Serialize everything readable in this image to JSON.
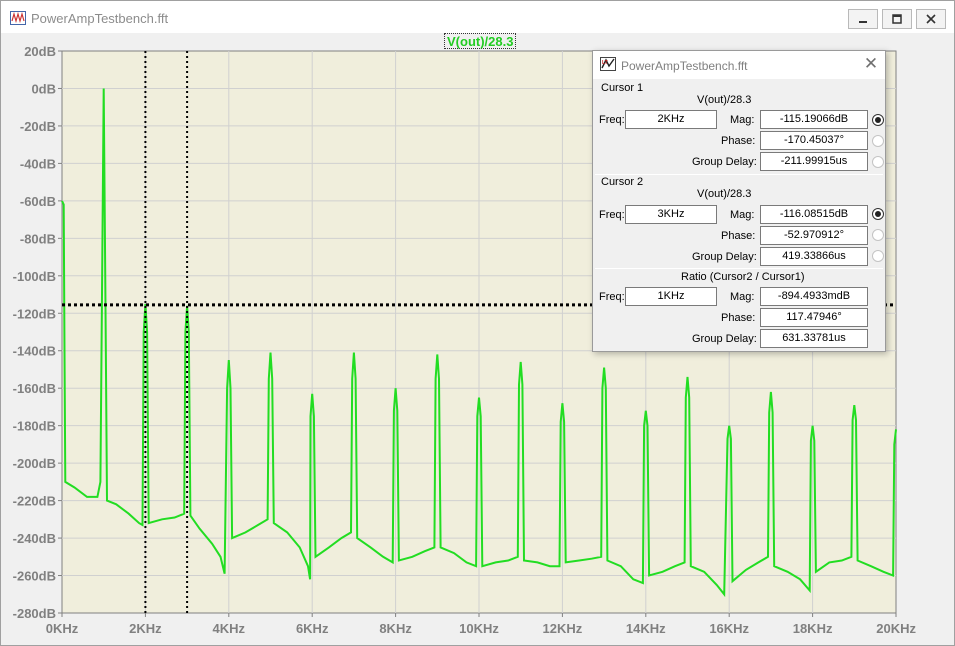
{
  "window": {
    "title": "PowerAmpTestbench.fft",
    "icon": "waveform-app-icon",
    "buttons": [
      "minimize-icon",
      "maximize-icon",
      "close-icon"
    ]
  },
  "trace_label": "V(out)/28.3",
  "colors": {
    "trace": "#22dd22",
    "plot_background": "#f0eedc",
    "grid": "#d0d0d0",
    "tick_label": "#808080",
    "cursor": "#000000"
  },
  "chart_data": {
    "type": "line",
    "title": "",
    "xlabel": "",
    "ylabel": "",
    "xlim": [
      0,
      20000
    ],
    "ylim": [
      -280,
      20
    ],
    "x_unit": "Hz",
    "y_unit": "dB",
    "x_ticks": [
      "0KHz",
      "2KHz",
      "4KHz",
      "6KHz",
      "8KHz",
      "10KHz",
      "12KHz",
      "14KHz",
      "16KHz",
      "18KHz",
      "20KHz"
    ],
    "y_ticks": [
      "20dB",
      "0dB",
      "-20dB",
      "-40dB",
      "-60dB",
      "-80dB",
      "-100dB",
      "-120dB",
      "-140dB",
      "-160dB",
      "-180dB",
      "-200dB",
      "-220dB",
      "-240dB",
      "-260dB",
      "-280dB"
    ],
    "grid": true,
    "series": [
      {
        "name": "V(out)/28.3",
        "points": [
          [
            0,
            -60
          ],
          [
            40,
            -62
          ],
          [
            60,
            -140
          ],
          [
            80,
            -210
          ],
          [
            300,
            -213
          ],
          [
            600,
            -218
          ],
          [
            850,
            -218
          ],
          [
            920,
            -210
          ],
          [
            960,
            -110
          ],
          [
            1000,
            0
          ],
          [
            1040,
            -110
          ],
          [
            1080,
            -220
          ],
          [
            1300,
            -222
          ],
          [
            1600,
            -227
          ],
          [
            1850,
            -232
          ],
          [
            1930,
            -233
          ],
          [
            1960,
            -130
          ],
          [
            2000,
            -115
          ],
          [
            2040,
            -130
          ],
          [
            2080,
            -232
          ],
          [
            2400,
            -230
          ],
          [
            2700,
            -229
          ],
          [
            2930,
            -227
          ],
          [
            2960,
            -130
          ],
          [
            3000,
            -116
          ],
          [
            3040,
            -130
          ],
          [
            3080,
            -228
          ],
          [
            3300,
            -235
          ],
          [
            3600,
            -243
          ],
          [
            3800,
            -250
          ],
          [
            3900,
            -259
          ],
          [
            3960,
            -160
          ],
          [
            4000,
            -145
          ],
          [
            4040,
            -160
          ],
          [
            4080,
            -240
          ],
          [
            4400,
            -237
          ],
          [
            4700,
            -233
          ],
          [
            4930,
            -230
          ],
          [
            4960,
            -155
          ],
          [
            5000,
            -141
          ],
          [
            5040,
            -155
          ],
          [
            5080,
            -232
          ],
          [
            5400,
            -237
          ],
          [
            5700,
            -245
          ],
          [
            5900,
            -255
          ],
          [
            5950,
            -262
          ],
          [
            5960,
            -175
          ],
          [
            6000,
            -163
          ],
          [
            6040,
            -175
          ],
          [
            6080,
            -250
          ],
          [
            6400,
            -245
          ],
          [
            6700,
            -240
          ],
          [
            6930,
            -237
          ],
          [
            6960,
            -155
          ],
          [
            7000,
            -141
          ],
          [
            7040,
            -155
          ],
          [
            7080,
            -240
          ],
          [
            7400,
            -245
          ],
          [
            7700,
            -250
          ],
          [
            7930,
            -253
          ],
          [
            7960,
            -172
          ],
          [
            8000,
            -160
          ],
          [
            8040,
            -172
          ],
          [
            8080,
            -252
          ],
          [
            8400,
            -250
          ],
          [
            8700,
            -247
          ],
          [
            8930,
            -245
          ],
          [
            8960,
            -155
          ],
          [
            9000,
            -142
          ],
          [
            9040,
            -155
          ],
          [
            9080,
            -245
          ],
          [
            9400,
            -248
          ],
          [
            9700,
            -253
          ],
          [
            9930,
            -255
          ],
          [
            9960,
            -175
          ],
          [
            10000,
            -165
          ],
          [
            10040,
            -175
          ],
          [
            10080,
            -255
          ],
          [
            10400,
            -253
          ],
          [
            10700,
            -252
          ],
          [
            10930,
            -250
          ],
          [
            10960,
            -158
          ],
          [
            11000,
            -146
          ],
          [
            11040,
            -158
          ],
          [
            11080,
            -252
          ],
          [
            11400,
            -253
          ],
          [
            11700,
            -255
          ],
          [
            11930,
            -255
          ],
          [
            11960,
            -178
          ],
          [
            12000,
            -168
          ],
          [
            12040,
            -178
          ],
          [
            12080,
            -253
          ],
          [
            12400,
            -252
          ],
          [
            12700,
            -251
          ],
          [
            12930,
            -250
          ],
          [
            12960,
            -160
          ],
          [
            13000,
            -149
          ],
          [
            13040,
            -160
          ],
          [
            13080,
            -252
          ],
          [
            13400,
            -255
          ],
          [
            13700,
            -262
          ],
          [
            13930,
            -264
          ],
          [
            13960,
            -180
          ],
          [
            14000,
            -172
          ],
          [
            14040,
            -180
          ],
          [
            14080,
            -260
          ],
          [
            14400,
            -258
          ],
          [
            14700,
            -255
          ],
          [
            14930,
            -253
          ],
          [
            14960,
            -165
          ],
          [
            15000,
            -154
          ],
          [
            15040,
            -165
          ],
          [
            15080,
            -255
          ],
          [
            15400,
            -258
          ],
          [
            15700,
            -265
          ],
          [
            15880,
            -270
          ],
          [
            15960,
            -187
          ],
          [
            16000,
            -180
          ],
          [
            16040,
            -187
          ],
          [
            16080,
            -263
          ],
          [
            16400,
            -257
          ],
          [
            16700,
            -253
          ],
          [
            16930,
            -250
          ],
          [
            16960,
            -173
          ],
          [
            17000,
            -162
          ],
          [
            17040,
            -173
          ],
          [
            17080,
            -255
          ],
          [
            17400,
            -258
          ],
          [
            17700,
            -262
          ],
          [
            17930,
            -268
          ],
          [
            17960,
            -188
          ],
          [
            18000,
            -180
          ],
          [
            18040,
            -188
          ],
          [
            18080,
            -258
          ],
          [
            18400,
            -253
          ],
          [
            18700,
            -252
          ],
          [
            18930,
            -250
          ],
          [
            18960,
            -177
          ],
          [
            19000,
            -169
          ],
          [
            19040,
            -177
          ],
          [
            19080,
            -252
          ],
          [
            19400,
            -255
          ],
          [
            19700,
            -258
          ],
          [
            19930,
            -260
          ],
          [
            19960,
            -190
          ],
          [
            20000,
            -182
          ]
        ]
      }
    ],
    "cursors": {
      "vertical_x": [
        2000,
        3000
      ],
      "horizontal_y": -115.5,
      "style": "dotted"
    }
  },
  "dialog": {
    "title": "PowerAmpTestbench.fft",
    "cursor1": {
      "heading": "Cursor 1",
      "trace": "V(out)/28.3",
      "freq_label": "Freq:",
      "freq": "2KHz",
      "mag_label": "Mag:",
      "mag": "-115.19066dB",
      "phase_label": "Phase:",
      "phase": "-170.45037°",
      "gd_label": "Group Delay:",
      "gd": "-211.99915us",
      "selected": "mag"
    },
    "cursor2": {
      "heading": "Cursor 2",
      "trace": "V(out)/28.3",
      "freq_label": "Freq:",
      "freq": "3KHz",
      "mag_label": "Mag:",
      "mag": "-116.08515dB",
      "phase_label": "Phase:",
      "phase": "-52.970912°",
      "gd_label": "Group Delay:",
      "gd": "419.33866us",
      "selected": "mag"
    },
    "ratio": {
      "heading": "Ratio (Cursor2 / Cursor1)",
      "freq_label": "Freq:",
      "freq": "1KHz",
      "mag_label": "Mag:",
      "mag": "-894.4933mdB",
      "phase_label": "Phase:",
      "phase": "117.47946°",
      "gd_label": "Group Delay:",
      "gd": "631.33781us"
    }
  }
}
